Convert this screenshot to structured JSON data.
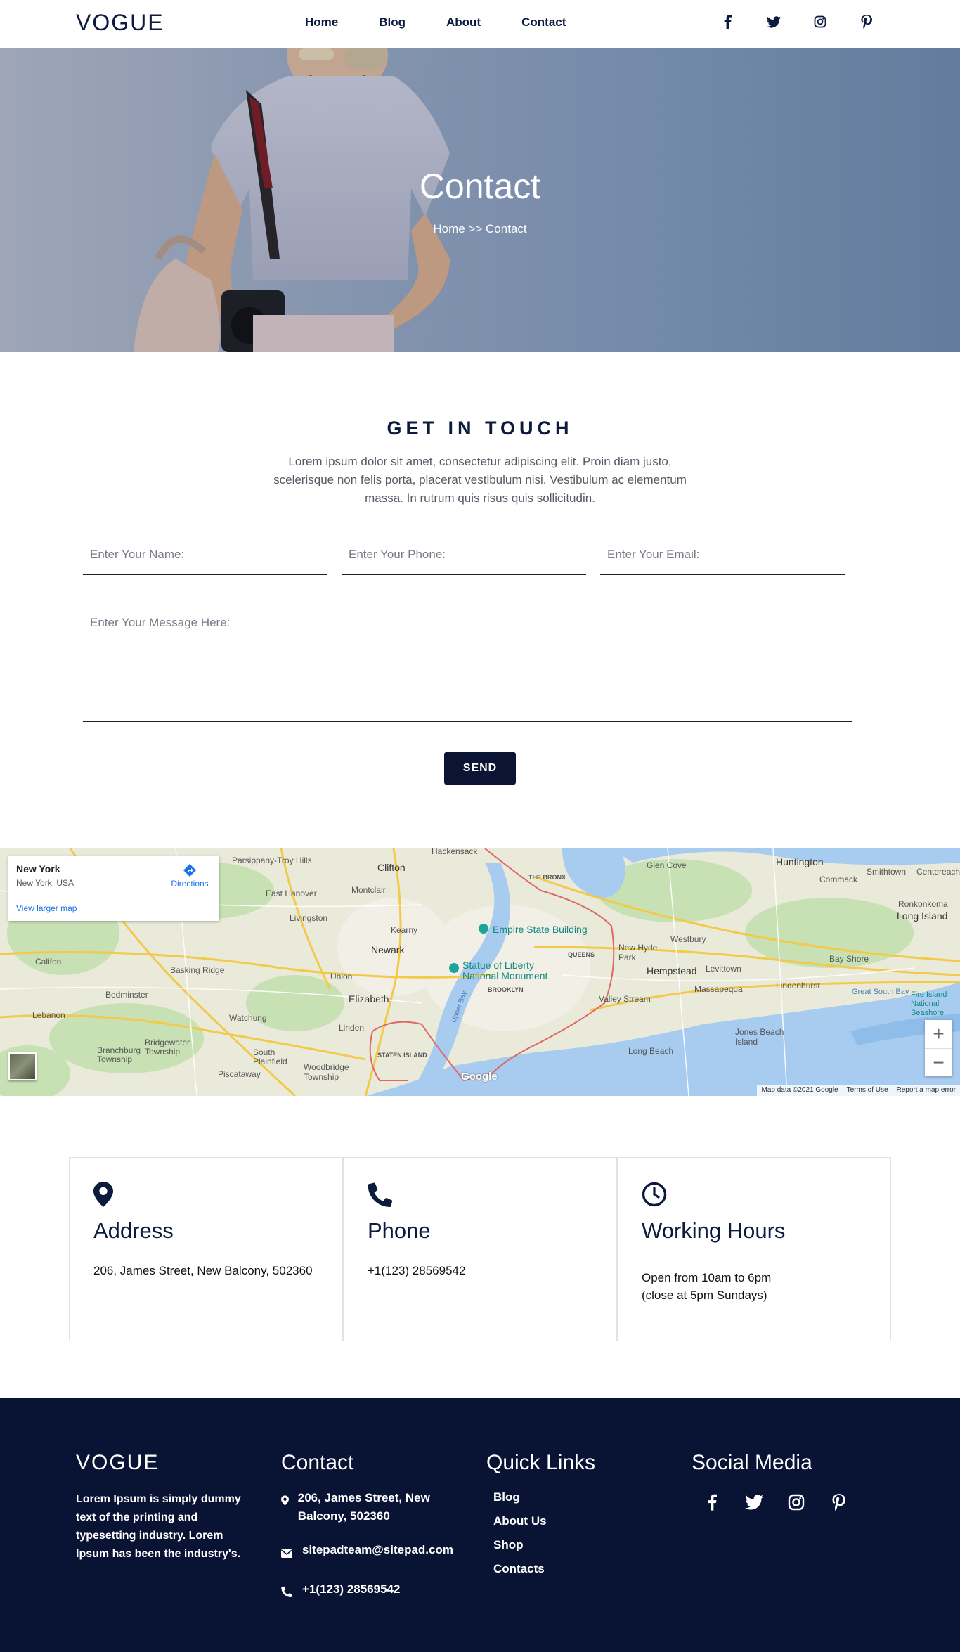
{
  "nav": {
    "logo": "VOGUE",
    "menu": [
      {
        "label": "Home"
      },
      {
        "label": "Blog"
      },
      {
        "label": "About"
      },
      {
        "label": "Contact"
      }
    ],
    "social_icons": [
      "facebook-icon",
      "twitter-icon",
      "instagram-icon",
      "pinterest-icon"
    ]
  },
  "hero": {
    "title": "Contact",
    "breadcrumb": "Home >> Contact"
  },
  "get_in_touch": {
    "title": "GET IN TOUCH",
    "description": "Lorem ipsum dolor sit amet, consectetur adipiscing elit. Proin diam justo, scelerisque non felis porta, placerat vestibulum nisi. Vestibulum ac elementum massa. In rutrum quis risus quis sollicitudin."
  },
  "form": {
    "name_placeholder": "Enter Your Name:",
    "phone_placeholder": "Enter Your Phone:",
    "email_placeholder": "Enter Your Email:",
    "message_placeholder": "Enter Your Message Here:",
    "send_label": "SEND"
  },
  "map": {
    "place_title": "New York",
    "place_subtitle": "New York, USA",
    "directions_label": "Directions",
    "larger_map_label": "View larger map",
    "zoom_in": "+",
    "zoom_out": "−",
    "google": "Google",
    "attribution": [
      "Map data ©2021 Google",
      "Terms of Use",
      "Report a map error"
    ],
    "labels": {
      "hackensack": "Hackensack",
      "clifton": "Clifton",
      "parsippany": "Parsippany-Troy Hills",
      "montclair": "Montclair",
      "bronx": "THE BRONX",
      "glencove": "Glen Cove",
      "huntington": "Huntington",
      "commack": "Commack",
      "smithtown": "Smithtown",
      "centereach": "Centereach",
      "ronkonkoma": "Ronkonkoma",
      "eastbrunswick": "East Hanover",
      "livingston": "Livingston",
      "kearny": "Kearny",
      "esb": "Empire State Building",
      "newhyde": "New Hyde Park",
      "westbury": "Westbury",
      "longisland": "Long Island",
      "newark": "Newark",
      "liberty": "Statue of Liberty National Monument",
      "queens": "QUEENS",
      "hempstead": "Hempstead",
      "levittown": "Levittown",
      "bayshore": "Bay Shore",
      "califon": "Califon",
      "baskingridge": "Basking Ridge",
      "union": "Union",
      "brooklyn": "BROOKLYN",
      "valleystream": "Valley Stream",
      "massapequa": "Massapequa",
      "lindenhurst": "Lindenhurst",
      "greatsouthbay": "Great South Bay",
      "fireisland": "Fire Island National Seashore",
      "bedminster": "Bedminster",
      "elizabeth": "Elizabeth",
      "lebanon": "Lebanon",
      "watchung": "Watchung",
      "linden": "Linden",
      "jonesbeach": "Jones Beach Island",
      "bridgewater": "Bridgewater Township",
      "branchburg": "Branchburg Township",
      "southplainfield": "South Plainfield",
      "statenisland": "STATEN ISLAND",
      "longbeach": "Long Beach",
      "woodbridge": "Woodbridge Township",
      "piscataway": "Piscataway",
      "upperbay": "Upper Bay"
    }
  },
  "info_cards": [
    {
      "icon": "location-pin-icon",
      "title": "Address",
      "text": "206, James Street, New Balcony, 502360"
    },
    {
      "icon": "phone-icon",
      "title": "Phone",
      "text": "+1(123) 28569542"
    },
    {
      "icon": "clock-icon",
      "title": "Working Hours",
      "line1": "Open from 10am to 6pm",
      "line2": "(close at 5pm Sundays)"
    }
  ],
  "footer": {
    "logo": "VOGUE",
    "description": "Lorem Ipsum is simply dummy text of the printing and typesetting industry. Lorem Ipsum has been the industry's.",
    "contact_title": "Contact",
    "address": "206, James Street, New Balcony, 502360",
    "email": "sitepadteam@sitepad.com",
    "phone": "+1(123) 28569542",
    "quick_links_title": "Quick Links",
    "quick_links": [
      "Blog",
      "About Us",
      "Shop",
      "Contacts"
    ],
    "social_title": "Social Media",
    "social_icons": [
      "facebook-icon",
      "twitter-icon",
      "instagram-icon",
      "pinterest-icon"
    ]
  },
  "colors": {
    "navy": "#0b1a3d",
    "footer_bg": "#091334",
    "button_bg": "#0b1432",
    "map_link": "#1a73e8"
  }
}
